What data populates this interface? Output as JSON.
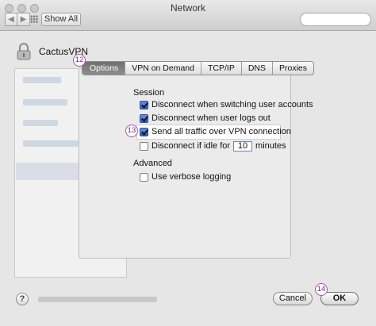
{
  "window": {
    "title": "Network"
  },
  "toolbar": {
    "back_glyph": "◀",
    "forward_glyph": "▶",
    "show_all_label": "Show All"
  },
  "service": {
    "name": "CactusVPN"
  },
  "tabs": [
    {
      "label": "Options",
      "selected": true
    },
    {
      "label": "VPN on Demand",
      "selected": false
    },
    {
      "label": "TCP/IP",
      "selected": false
    },
    {
      "label": "DNS",
      "selected": false
    },
    {
      "label": "Proxies",
      "selected": false
    }
  ],
  "session": {
    "heading": "Session",
    "options": [
      {
        "label": "Disconnect when switching user accounts",
        "checked": true
      },
      {
        "label": "Disconnect when user logs out",
        "checked": true
      },
      {
        "label": "Send all traffic over VPN connection",
        "checked": true
      },
      {
        "label_before": "Disconnect if idle for",
        "value": "10",
        "label_after": "minutes",
        "checked": false
      }
    ]
  },
  "advanced": {
    "heading": "Advanced",
    "options": [
      {
        "label": "Use verbose logging",
        "checked": false
      }
    ]
  },
  "buttons": {
    "help": "?",
    "cancel": "Cancel",
    "ok": "OK"
  },
  "callouts": {
    "tabs": "12",
    "send_all": "13",
    "ok": "14"
  },
  "colors": {
    "callout": "#b04fb0",
    "checkbox_checked": "#2f62c6",
    "tab_selected": "#7a7a7a"
  },
  "icons": {
    "lock": "lock-icon",
    "help": "help-icon",
    "grid": "grid-icon"
  }
}
